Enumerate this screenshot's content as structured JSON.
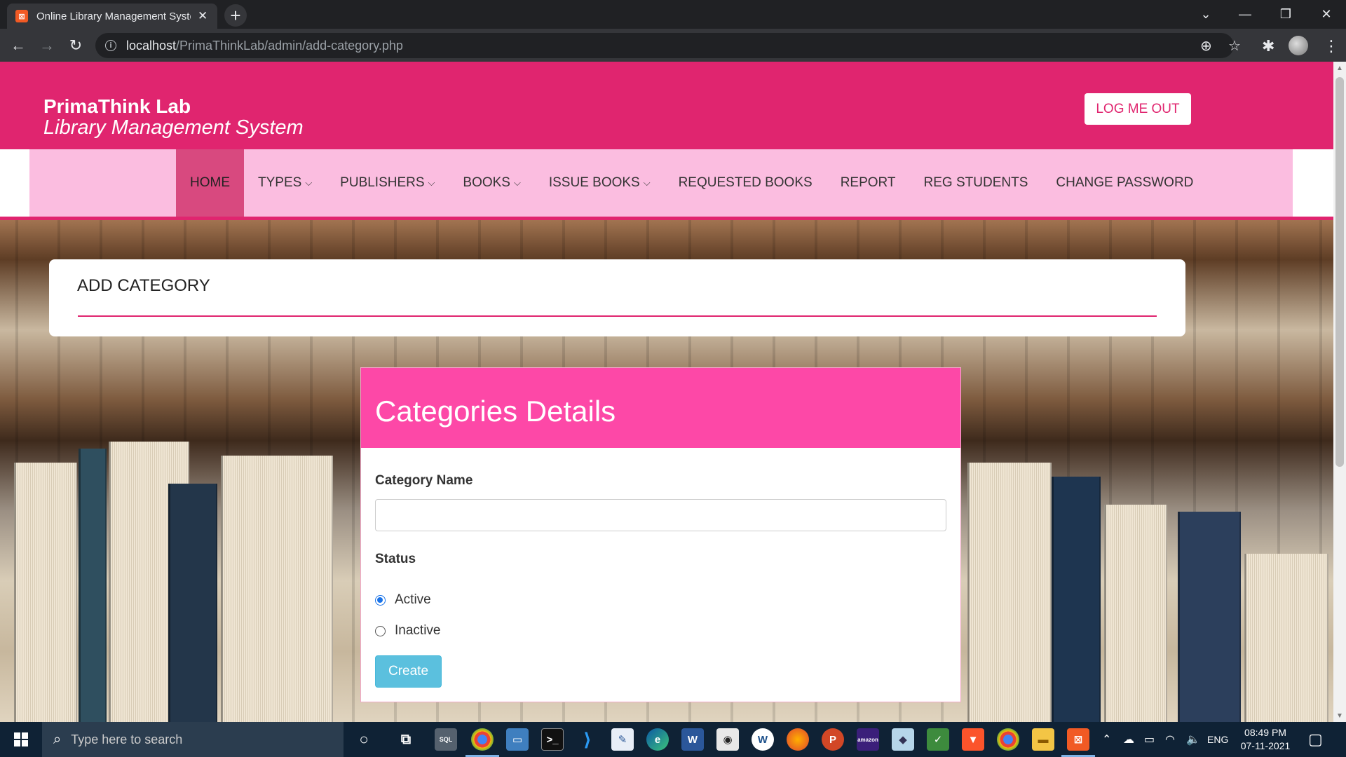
{
  "browser": {
    "tab_title": "Online Library Management System",
    "url_host": "localhost",
    "url_path": "/PrimaThinkLab/admin/add-category.php"
  },
  "header": {
    "brand_name": "PrimaThink Lab",
    "brand_sub": "Library Management System",
    "logout_label": "LOG ME OUT"
  },
  "nav": {
    "items": [
      {
        "label": "HOME",
        "active": true,
        "dropdown": false
      },
      {
        "label": "TYPES",
        "active": false,
        "dropdown": true
      },
      {
        "label": "PUBLISHERS",
        "active": false,
        "dropdown": true
      },
      {
        "label": "BOOKS",
        "active": false,
        "dropdown": true
      },
      {
        "label": "ISSUE BOOKS",
        "active": false,
        "dropdown": true
      },
      {
        "label": "REQUESTED BOOKS",
        "active": false,
        "dropdown": false
      },
      {
        "label": "REPORT",
        "active": false,
        "dropdown": false
      },
      {
        "label": "REG STUDENTS",
        "active": false,
        "dropdown": false
      },
      {
        "label": "CHANGE PASSWORD",
        "active": false,
        "dropdown": false
      }
    ]
  },
  "page": {
    "title": "ADD CATEGORY"
  },
  "form": {
    "card_title": "Categories Details",
    "category_label": "Category Name",
    "category_value": "",
    "status_label": "Status",
    "options": [
      {
        "label": "Active",
        "checked": true
      },
      {
        "label": "Inactive",
        "checked": false
      }
    ],
    "submit_label": "Create"
  },
  "taskbar": {
    "search_placeholder": "Type here to search",
    "language": "ENG",
    "time": "08:49 PM",
    "date": "07-11-2021"
  },
  "colors": {
    "brand": "#e0256f",
    "nav_bg": "#fbbde0",
    "card_header": "#fd48a7",
    "button": "#5bc0de"
  }
}
